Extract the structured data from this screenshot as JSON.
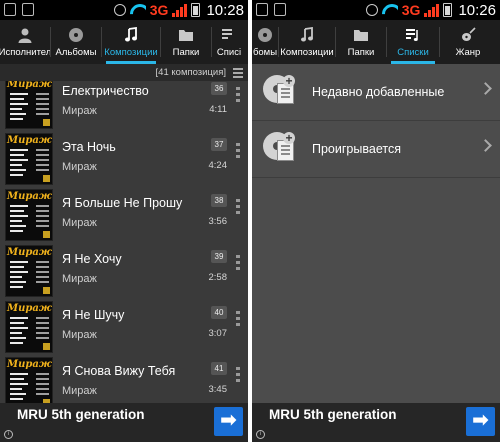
{
  "left": {
    "status": {
      "network": "3G",
      "time": "10:28"
    },
    "tabs": [
      {
        "label": "Исполнител",
        "icon": "person-icon"
      },
      {
        "label": "Альбомы",
        "icon": "disc-icon"
      },
      {
        "label": "Композиции",
        "icon": "music-note-icon",
        "active": true
      },
      {
        "label": "Папки",
        "icon": "folder-icon"
      },
      {
        "label": "Списі",
        "icon": "playlist-icon"
      }
    ],
    "track_count": "[41 композиция]",
    "tracks": [
      {
        "title": "Електричество",
        "artist": "Мираж",
        "number": "36",
        "duration": "4:11"
      },
      {
        "title": "Эта Ночь",
        "artist": "Мираж",
        "number": "37",
        "duration": "4:24"
      },
      {
        "title": "Я Больше Не Прошу",
        "artist": "Мираж",
        "number": "38",
        "duration": "3:56"
      },
      {
        "title": "Я Не Хочу",
        "artist": "Мираж",
        "number": "39",
        "duration": "2:58"
      },
      {
        "title": "Я Не Шучу",
        "artist": "Мираж",
        "number": "40",
        "duration": "3:07"
      },
      {
        "title": "Я Снова Вижу Тебя",
        "artist": "Мираж",
        "number": "41",
        "duration": "3:45"
      }
    ],
    "ad": {
      "text": "MRU 5th generation",
      "button": "➡",
      "info": "i"
    }
  },
  "right": {
    "status": {
      "network": "3G",
      "time": "10:26"
    },
    "tabs": [
      {
        "label": "бомы",
        "icon": "disc-icon"
      },
      {
        "label": "Композиции",
        "icon": "music-note-icon"
      },
      {
        "label": "Папки",
        "icon": "folder-icon"
      },
      {
        "label": "Списки",
        "icon": "playlist-icon",
        "active": true
      },
      {
        "label": "Жанр",
        "icon": "guitar-icon"
      }
    ],
    "playlists": [
      {
        "label": "Недавно добавленные"
      },
      {
        "label": "Проигрывается"
      }
    ],
    "ad": {
      "text": "MRU 5th generation",
      "button": "➡",
      "info": "i"
    }
  },
  "colors": {
    "accent": "#2bb7e8",
    "network_3g": "#ff3b1f",
    "ad_button": "#1a6fd6",
    "cover_logo": "#f0b21c"
  }
}
